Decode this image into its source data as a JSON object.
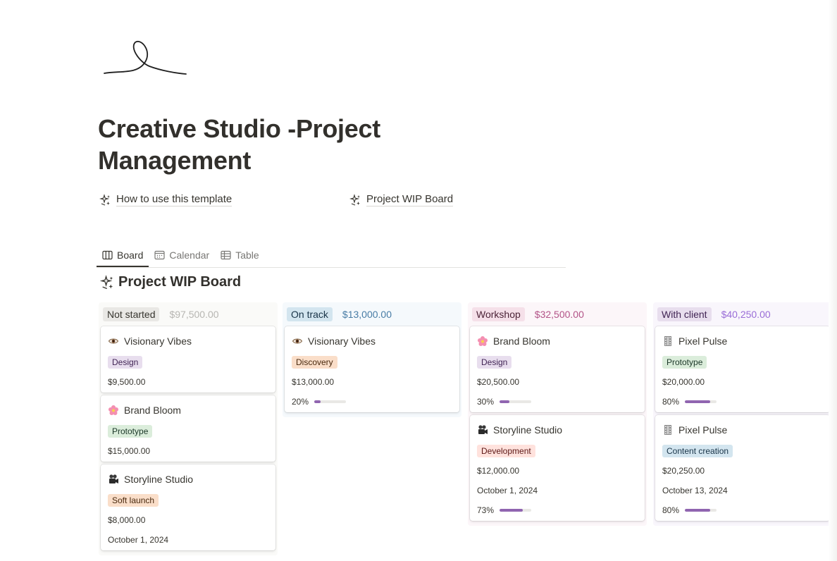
{
  "page": {
    "title": "Creative Studio -Project Management",
    "links": [
      {
        "label": "How to use this template",
        "icon": "sparkles-icon"
      },
      {
        "label": "Project WIP Board",
        "icon": "sparkles-icon"
      }
    ]
  },
  "views": {
    "tabs": [
      {
        "label": "Board",
        "icon": "board-icon",
        "active": true
      },
      {
        "label": "Calendar",
        "icon": "calendar-icon",
        "active": false
      },
      {
        "label": "Table",
        "icon": "table-icon",
        "active": false
      }
    ]
  },
  "board": {
    "title": "Project WIP Board",
    "columns": [
      {
        "status": "Not started",
        "total": "$97,500.00",
        "bg": "#fafaf8",
        "tag_bg": "#e9e8e5",
        "tag_fg": "#37352f",
        "sum_fg": "#b7b6b2",
        "cards": [
          {
            "name": "Visionary Vibes",
            "icon": "eye-icon",
            "tag": "Design",
            "tag_bg": "#e8deee",
            "tag_fg": "#412454",
            "amount": "$9,500.00"
          },
          {
            "name": "Brand Bloom",
            "icon": "flower-icon",
            "tag": "Prototype",
            "tag_bg": "#dbeddb",
            "tag_fg": "#1c3829",
            "amount": "$15,000.00"
          },
          {
            "name": "Storyline Studio",
            "icon": "camera-icon",
            "tag": "Soft launch",
            "tag_bg": "#fadec9",
            "tag_fg": "#49290e",
            "amount": "$8,000.00",
            "date": "October 1, 2024"
          }
        ]
      },
      {
        "status": "On track",
        "total": "$13,000.00",
        "bg": "#f5f9fc",
        "tag_bg": "#d3e5ef",
        "tag_fg": "#183347",
        "sum_fg": "#487ca5",
        "cards": [
          {
            "name": "Visionary Vibes",
            "icon": "eye-icon",
            "tag": "Discovery",
            "tag_bg": "#fadec9",
            "tag_fg": "#49290e",
            "amount": "$13,000.00",
            "progress_label": "20%",
            "progress": 0.2
          }
        ]
      },
      {
        "status": "Workshop",
        "total": "$32,500.00",
        "bg": "#fcf6f9",
        "tag_bg": "#f5e0e9",
        "tag_fg": "#4c2337",
        "sum_fg": "#b35488",
        "cards": [
          {
            "name": "Brand Bloom",
            "icon": "flower-icon",
            "tag": "Design",
            "tag_bg": "#e8deee",
            "tag_fg": "#412454",
            "amount": "$20,500.00",
            "progress_label": "30%",
            "progress": 0.3
          },
          {
            "name": "Storyline Studio",
            "icon": "camera-icon",
            "tag": "Development",
            "tag_bg": "#ffe2dd",
            "tag_fg": "#5d1715",
            "amount": "$12,000.00",
            "date": "October 1, 2024",
            "progress_label": "73%",
            "progress": 0.73
          }
        ]
      },
      {
        "status": "With client",
        "total": "$40,250.00",
        "bg": "#f9f6fc",
        "tag_bg": "#e8deee",
        "tag_fg": "#412454",
        "sum_fg": "#9a6dd7",
        "cards": [
          {
            "name": "Pixel Pulse",
            "icon": "film-icon",
            "tag": "Prototype",
            "tag_bg": "#dbeddb",
            "tag_fg": "#1c3829",
            "amount": "$20,000.00",
            "progress_label": "80%",
            "progress": 0.8
          },
          {
            "name": "Pixel Pulse",
            "icon": "film-icon",
            "tag": "Content creation",
            "tag_bg": "#d3e5ef",
            "tag_fg": "#183347",
            "amount": "$20,250.00",
            "date": "October 13, 2024",
            "progress_label": "80%",
            "progress": 0.8
          }
        ]
      }
    ]
  }
}
